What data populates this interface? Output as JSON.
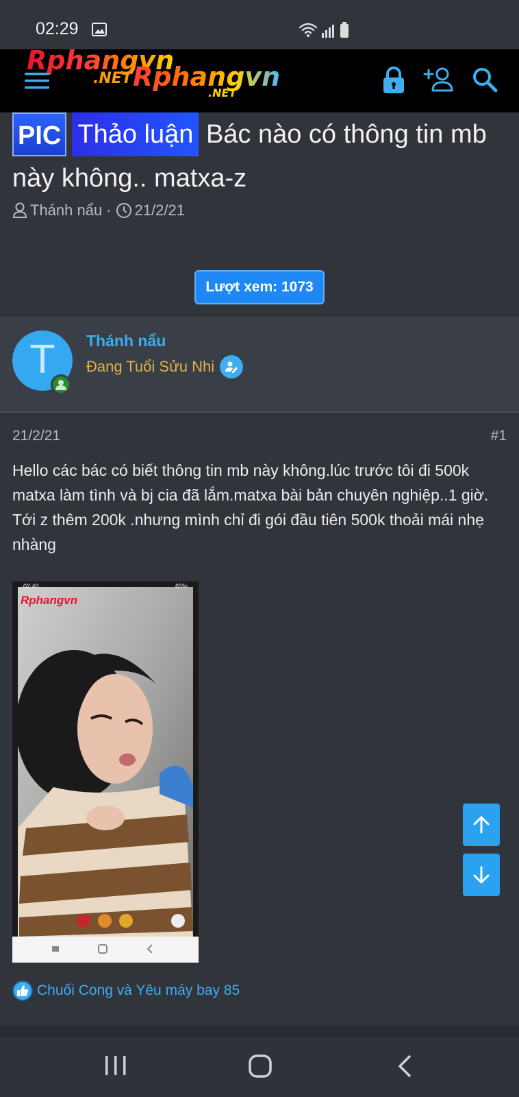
{
  "status_bar": {
    "time": "02:29",
    "icons": [
      "image-icon",
      "wifi-icon",
      "signal-icon",
      "battery-icon"
    ]
  },
  "nav": {
    "logo": {
      "word1": "Rphangvn",
      "net1": ".NET",
      "word2": "Rphangvn",
      "net2": ".NET"
    },
    "icons": [
      "menu-icon",
      "lock-icon",
      "add-user-icon",
      "search-icon"
    ]
  },
  "thread": {
    "prefix_pic": "PIC",
    "prefix_discussion": "Thảo luận",
    "title": "Bác nào có thông tin mb này không.. matxa-z",
    "author": "Thánh nẩu",
    "separator": "·",
    "date": "21/2/21",
    "views_label": "Lượt xem: 1073"
  },
  "user": {
    "avatar_letter": "T",
    "name": "Thánh nẩu",
    "title": "Đang Tuổi Sửu Nhi"
  },
  "post": {
    "date": "21/2/21",
    "number": "#1",
    "body": "Hello các bác có biết thông tin mb này không.lúc trước tôi đi 500k matxa làm tình và bj cia đã lắm.matxa bài bản chuyên nghiệp..1 giờ. Tới z thêm 200k .nhưng mình chỉ đi gói đầu tiên 500k thoải mái nhẹ nhàng",
    "attachment": {
      "time": "02:40",
      "battery": "65%",
      "logo": "Rphangvn"
    },
    "reactions": "Chuối Cong và Yêu máy bay 85"
  },
  "colors": {
    "background": "#31343b",
    "accent": "#3daef0",
    "views_badge": "#1f88f2",
    "user_title": "#e0b34a"
  }
}
